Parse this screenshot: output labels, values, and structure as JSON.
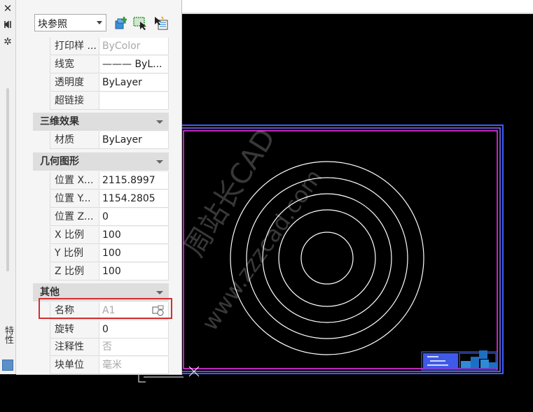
{
  "colors": {
    "panel_bg": "#f5f5f5",
    "section_bg": "#dedede",
    "highlight": "#d32f2f",
    "frame_outer": "#3b5bff",
    "frame_inner": "#ff33ff",
    "circle": "#ffffff",
    "titleblock": "#4d6bff"
  },
  "leftbar": {
    "close_icon": "close-icon",
    "pin_icon": "autohide-icon",
    "settings_icon": "gear-icon",
    "title": "特性"
  },
  "toolbar": {
    "selector_value": "块参照",
    "quick_select_icon": "quick-select-icon",
    "select_objects_icon": "select-objects-icon",
    "pickadd_icon": "pickadd-toggle-icon"
  },
  "rows_top": [
    {
      "label": "打印样 ...",
      "value": "ByColor",
      "gray": true
    },
    {
      "label": "线宽",
      "value": "——— ByL..."
    },
    {
      "label": "透明度",
      "value": "ByLayer"
    },
    {
      "label": "超链接",
      "value": ""
    }
  ],
  "sections": {
    "three_d": "三维效果",
    "geometry": "几何图形",
    "misc": "其他"
  },
  "row_material": {
    "label": "材质",
    "value": "ByLayer"
  },
  "rows_geometry": [
    {
      "label": "位置 X...",
      "value": "2115.8997"
    },
    {
      "label": "位置 Y...",
      "value": "1154.2805"
    },
    {
      "label": "位置 Z...",
      "value": "0"
    },
    {
      "label": "X 比例",
      "value": "100"
    },
    {
      "label": "Y 比例",
      "value": "100"
    },
    {
      "label": "Z 比例",
      "value": "100"
    }
  ],
  "rows_misc": [
    {
      "label": "名称",
      "value": "A1",
      "gray": true
    },
    {
      "label": "旋转",
      "value": "0"
    },
    {
      "label": "注释性",
      "value": "否",
      "gray": true
    },
    {
      "label": "块单位",
      "value": "毫米",
      "gray": true
    }
  ],
  "watermark": {
    "line1": "周站长CAD",
    "line2": "www.zzzcad.com"
  }
}
